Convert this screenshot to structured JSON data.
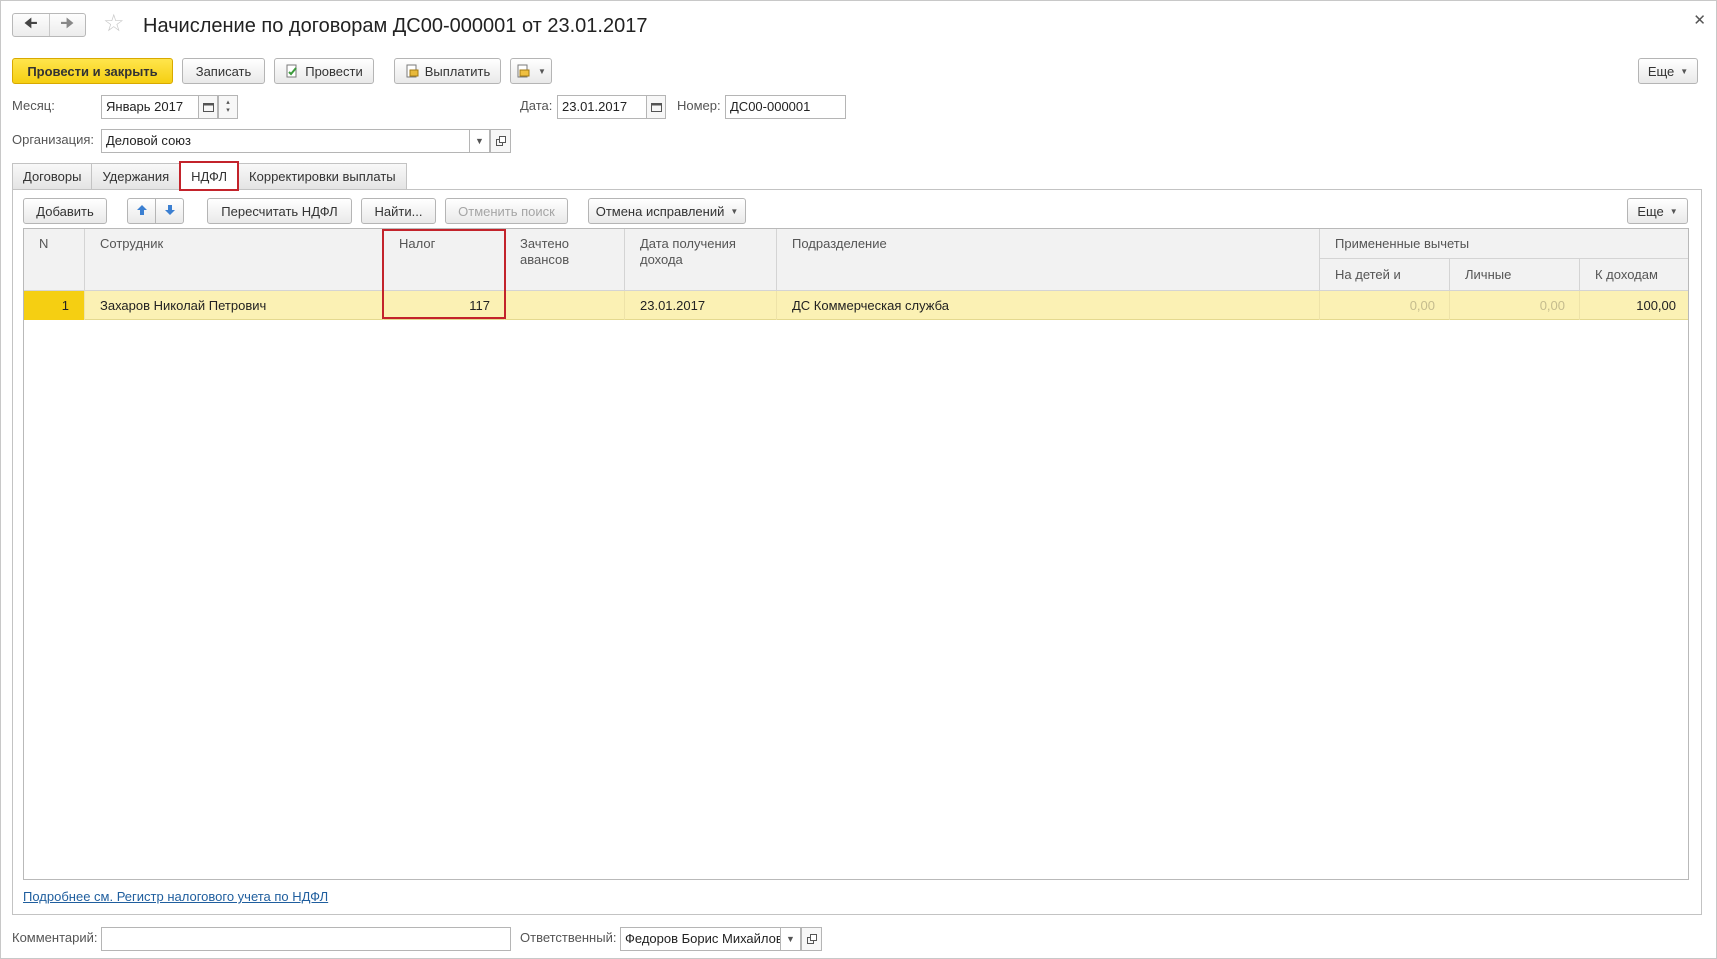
{
  "window": {
    "title": "Начисление по договорам ДС00-000001 от 23.01.2017",
    "back_icon": "back-arrow-icon",
    "forward_icon": "forward-arrow-icon",
    "favorite_icon": "star-icon",
    "close_icon": "close-icon"
  },
  "toolbar": {
    "post_close_label": "Провести и закрыть",
    "save_label": "Записать",
    "post_label": "Провести",
    "pay_label": "Выплатить",
    "more_label": "Еще"
  },
  "header_fields": {
    "month_label": "Месяц:",
    "month_value": "Январь 2017",
    "date_label": "Дата:",
    "date_value": "23.01.2017",
    "number_label": "Номер:",
    "number_value": "ДС00-000001",
    "org_label": "Организация:",
    "org_value": "Деловой союз"
  },
  "tabs": [
    {
      "label": "Договоры"
    },
    {
      "label": "Удержания"
    },
    {
      "label": "НДФЛ",
      "active": true
    },
    {
      "label": "Корректировки выплаты"
    }
  ],
  "table_toolbar": {
    "add_label": "Добавить",
    "recalc_label": "Пересчитать НДФЛ",
    "find_label": "Найти...",
    "cancel_search_label": "Отменить поиск",
    "cancel_corrections_label": "Отмена исправлений",
    "more_label": "Еще"
  },
  "table": {
    "columns": {
      "n": "N",
      "employee": "Сотрудник",
      "tax": "Налог",
      "advances": "Зачтено авансов",
      "income_date": "Дата получения дохода",
      "department": "Подразделение",
      "deductions_group": "Примененные вычеты",
      "children": "На детей и",
      "personal": "Личные",
      "income": "К доходам"
    },
    "rows": [
      {
        "n": "1",
        "employee": "Захаров Николай Петрович",
        "tax": "117",
        "advances": "",
        "income_date": "23.01.2017",
        "department": "ДС Коммерческая служба",
        "children": "0,00",
        "personal": "0,00",
        "income": "100,00"
      }
    ]
  },
  "footer": {
    "link_text": "Подробнее см. Регистр налогового учета по НДФЛ",
    "comment_label": "Комментарий:",
    "comment_value": "",
    "responsible_label": "Ответственный:",
    "responsible_value": "Федоров Борис Михайлов"
  },
  "colors": {
    "primary_button": "#f5cf12",
    "selected_row": "#fbf1b4",
    "highlight": "#c3232b",
    "link": "#1f5e9e"
  }
}
